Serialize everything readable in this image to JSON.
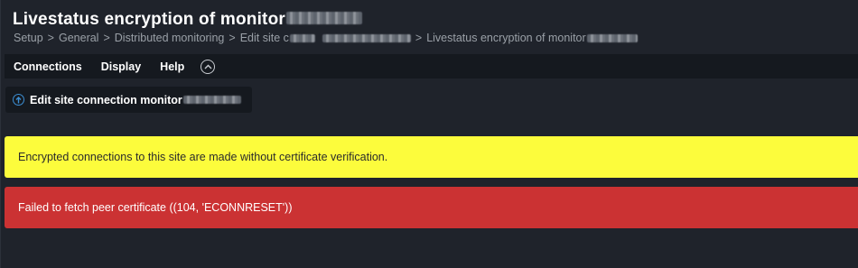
{
  "header": {
    "title": "Livestatus encryption of monitor",
    "breadcrumb": {
      "setup": "Setup",
      "general": "General",
      "distributed": "Distributed monitoring",
      "edit_site": "Edit site c",
      "current": "Livestatus encryption of monitor",
      "separator": ">"
    }
  },
  "menubar": {
    "items": [
      "Connections",
      "Display",
      "Help"
    ],
    "collapse_icon": "chevron-up-circle-icon"
  },
  "action": {
    "label": "Edit site connection monitor",
    "icon": "arrow-up-circle-icon"
  },
  "messages": {
    "warning": "Encrypted connections to this site are made without certificate verification.",
    "error": "Failed to fetch peer certificate ((104, 'ECONNRESET'))"
  },
  "colors": {
    "background": "#1f232b",
    "menubar": "#15191f",
    "warning": "#fcfc3c",
    "error": "#cb3233",
    "accent": "#3c8ed3"
  }
}
